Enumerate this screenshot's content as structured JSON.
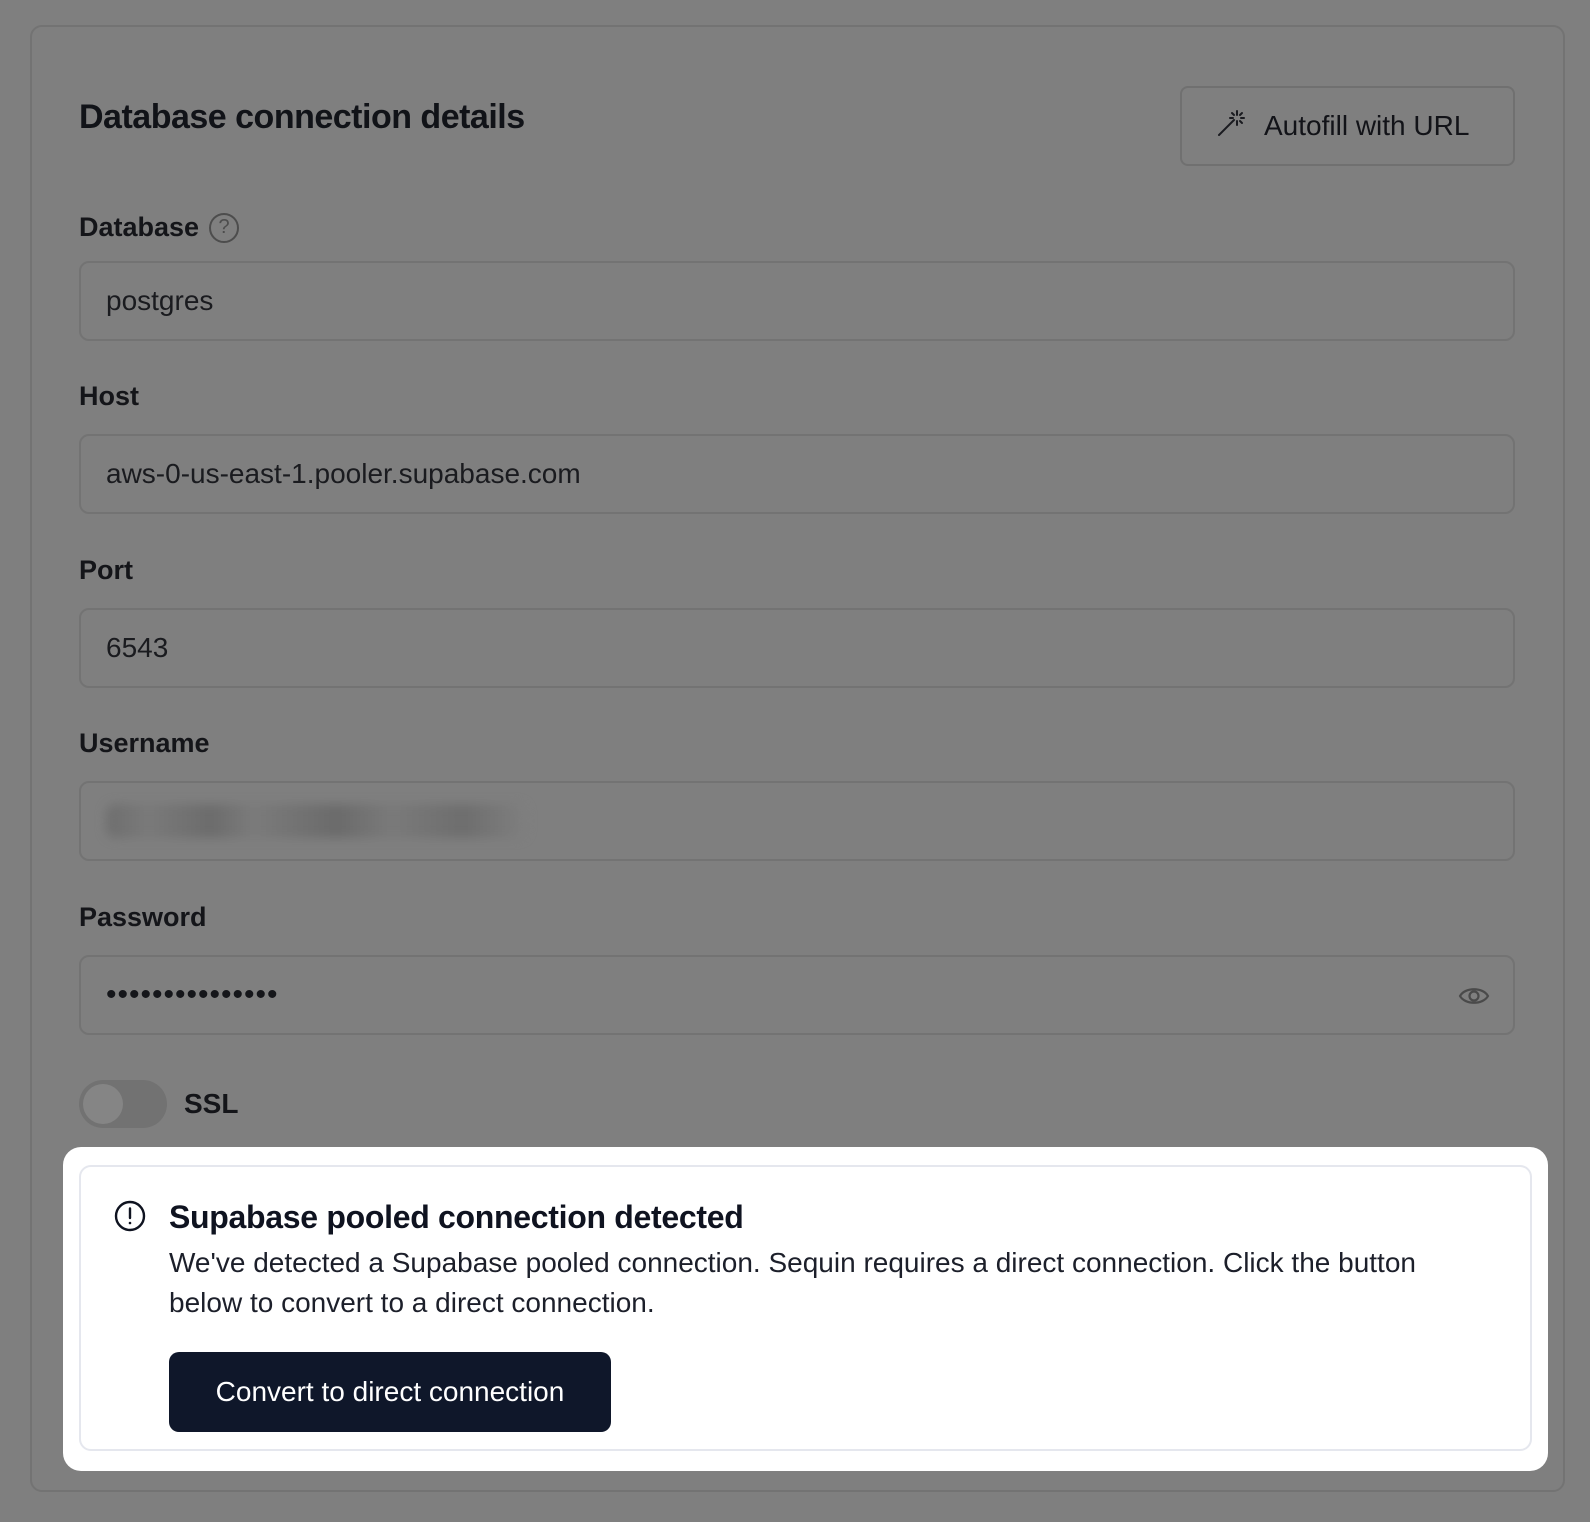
{
  "header": {
    "title": "Database connection details",
    "autofill_label": "Autofill with URL",
    "autofill_icon": "magic-wand-icon"
  },
  "fields": {
    "database": {
      "label": "Database",
      "value": "postgres",
      "help_icon": "question-circle-icon",
      "help_glyph": "?"
    },
    "host": {
      "label": "Host",
      "value": "aws-0-us-east-1.pooler.supabase.com"
    },
    "port": {
      "label": "Port",
      "value": "6543"
    },
    "username": {
      "label": "Username",
      "value": ""
    },
    "password": {
      "label": "Password",
      "masked_value": "•••••••••••••••",
      "reveal_icon": "eye-icon"
    }
  },
  "ssl": {
    "label": "SSL",
    "enabled": false
  },
  "alert": {
    "icon": "exclamation-circle-icon",
    "title": "Supabase pooled connection detected",
    "message": "We've detected a Supabase pooled connection. Sequin requires a direct connection. Click the button below to convert to a direct connection.",
    "button_label": "Convert to direct connection"
  },
  "colors": {
    "overlay": "#7f7f7f",
    "button_dark": "#0f172a",
    "alert_border": "#e5e7ee"
  }
}
